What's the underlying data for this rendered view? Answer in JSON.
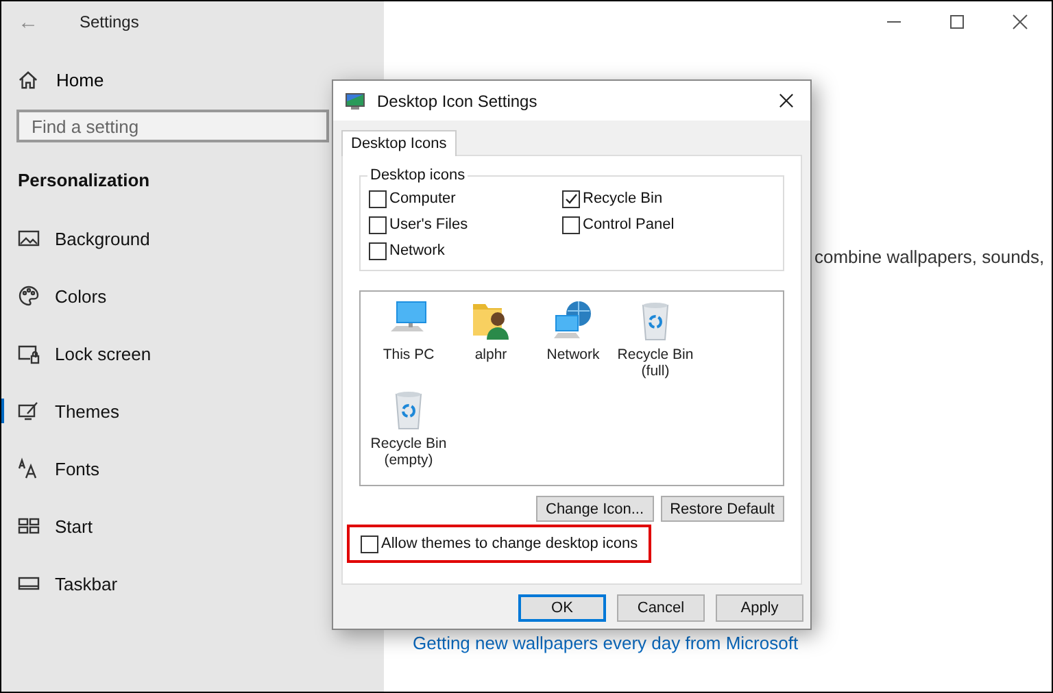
{
  "window": {
    "title": "Settings",
    "back": "←"
  },
  "sidebar": {
    "home": "Home",
    "search": {
      "placeholder": "Find a setting"
    },
    "section": "Personalization",
    "items": [
      {
        "label": "Background",
        "selected": false
      },
      {
        "label": "Colors",
        "selected": false
      },
      {
        "label": "Lock screen",
        "selected": false
      },
      {
        "label": "Themes",
        "selected": true
      },
      {
        "label": "Fonts",
        "selected": false
      },
      {
        "label": "Start",
        "selected": false
      },
      {
        "label": "Taskbar",
        "selected": false
      }
    ]
  },
  "content": {
    "description": "combine wallpapers, sounds,",
    "link": "Getting new wallpapers every day from Microsoft"
  },
  "dialog": {
    "title": "Desktop Icon Settings",
    "tabs": [
      {
        "label": "Desktop Icons",
        "selected": true
      }
    ],
    "group": "Desktop icons",
    "checkboxes": [
      {
        "label": "Computer",
        "checked": false
      },
      {
        "label": "Recycle Bin",
        "checked": true
      },
      {
        "label": "User's Files",
        "checked": false
      },
      {
        "label": "Control Panel",
        "checked": false
      },
      {
        "label": "Network",
        "checked": false
      }
    ],
    "icons": [
      {
        "label": "This PC",
        "kind": "computer"
      },
      {
        "label": "alphr",
        "kind": "user"
      },
      {
        "label": "Network",
        "kind": "network"
      },
      {
        "label": "Recycle Bin (full)",
        "kind": "bin"
      },
      {
        "label": "Recycle Bin (empty)",
        "kind": "bin"
      }
    ],
    "icon_buttons": [
      "Change Icon...",
      "Restore Default"
    ],
    "allow": {
      "label": "Allow themes to change desktop icons",
      "checked": false,
      "highlighted": true
    },
    "buttons": [
      {
        "label": "OK",
        "default": true
      },
      {
        "label": "Cancel",
        "default": false
      },
      {
        "label": "Apply",
        "default": false
      }
    ]
  }
}
